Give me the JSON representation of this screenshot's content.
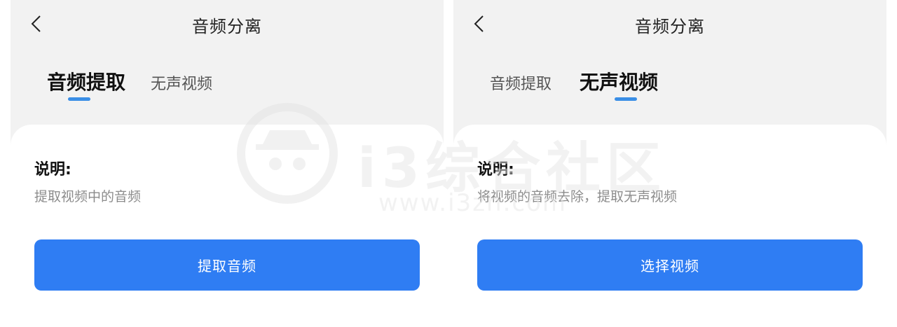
{
  "panels": [
    {
      "title": "音频分离",
      "tabs": [
        {
          "label": "音频提取",
          "active": true
        },
        {
          "label": "无声视频",
          "active": false
        }
      ],
      "description": {
        "heading": "说明:",
        "text": "提取视频中的音频"
      },
      "action_label": "提取音频"
    },
    {
      "title": "音频分离",
      "tabs": [
        {
          "label": "音频提取",
          "active": false
        },
        {
          "label": "无声视频",
          "active": true
        }
      ],
      "description": {
        "heading": "说明:",
        "text": "将视频的音频去除，提取无声视频"
      },
      "action_label": "选择视频"
    }
  ],
  "watermark": {
    "text": "i3综合社区",
    "url": "www.i3zh.com"
  },
  "colors": {
    "accent": "#2f7df3",
    "tab_indicator": "#3a8ee6",
    "panel_bg": "#f2f2f2",
    "sheet_bg": "#ffffff",
    "muted_text": "#8c8c8c"
  },
  "icons": [
    "chevron-left-icon"
  ]
}
